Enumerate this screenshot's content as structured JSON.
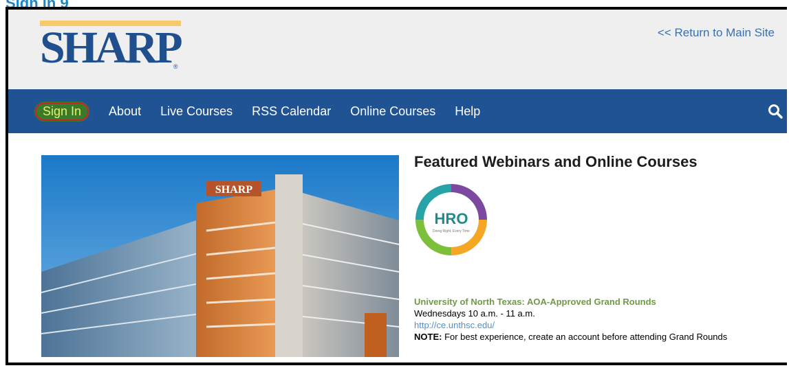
{
  "brand": {
    "logo_text": "SHARP",
    "registered_mark": "®"
  },
  "header": {
    "return_link": "<< Return to Main Site"
  },
  "nav": {
    "items": [
      {
        "label": "Sign In"
      },
      {
        "label": "About"
      },
      {
        "label": "Live Courses"
      },
      {
        "label": "RSS Calendar"
      },
      {
        "label": "Online Courses"
      },
      {
        "label": "Help"
      }
    ],
    "search_icon": "search-icon"
  },
  "hero": {
    "building_sign": "SHARP"
  },
  "featured": {
    "title": "Featured Webinars and Online Courses",
    "hro": {
      "label": "HRO",
      "tagline": "Doing Right, Every Time"
    },
    "university": "University of North Texas:  AOA-Approved Grand Rounds",
    "schedule": "Wednesdays 10 a.m. - 11 a.m.",
    "url": "http://ce.unthsc.edu/",
    "note_label": "NOTE:",
    "note_text": " For best experience, create an account before attending Grand Rounds"
  },
  "colors": {
    "nav_bg": "#1f5394",
    "header_bg": "#efefef",
    "logo_blue": "#1f4f8c",
    "logo_gold": "#f7c96a",
    "link_blue": "#3a6fb0",
    "signin_highlight": "#3b7a2a",
    "signin_circle": "#c02828",
    "university_green": "#6f9a45"
  }
}
